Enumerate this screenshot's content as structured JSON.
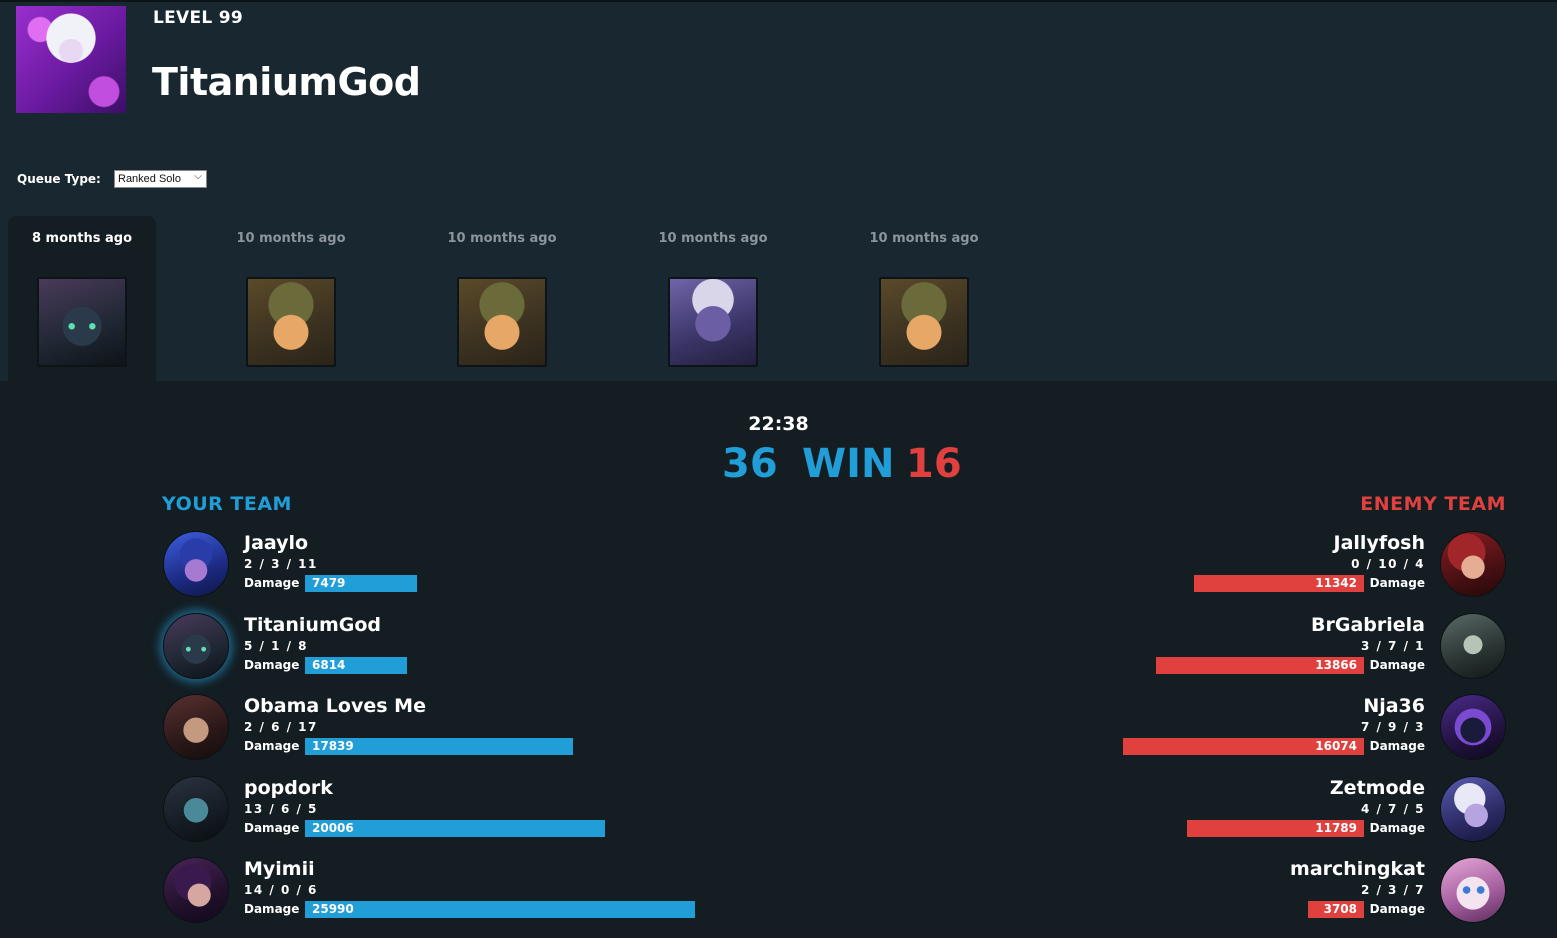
{
  "profile": {
    "level": "LEVEL 99",
    "name": "TitaniumGod",
    "avatar_icon": "profile-avatar-icon"
  },
  "queue": {
    "label": "Queue Type:",
    "selected": "Ranked Solo"
  },
  "matches": [
    {
      "time": "8 months ago",
      "champion_icon": "kindred-icon",
      "active": true
    },
    {
      "time": "10 months ago",
      "champion_icon": "teemo-icon",
      "active": false
    },
    {
      "time": "10 months ago",
      "champion_icon": "teemo-icon",
      "active": false
    },
    {
      "time": "10 months ago",
      "champion_icon": "poppy-icon",
      "active": false
    },
    {
      "time": "10 months ago",
      "champion_icon": "teemo-icon",
      "active": false
    }
  ],
  "match_detail": {
    "duration": "22:38",
    "ally_kills": "36",
    "result": "WIN",
    "enemy_kills": "16",
    "colors": {
      "ally": "#219dd8",
      "enemy": "#e0403e"
    },
    "your_team": {
      "title": "YOUR TEAM",
      "damage_label": "Damage",
      "players": [
        {
          "name": "Jaaylo",
          "kda": "2 / 3 / 11",
          "damage": "7479",
          "champion_icon": "tristana-icon"
        },
        {
          "name": "TitaniumGod",
          "kda": "5 / 1 / 8",
          "damage": "6814",
          "champion_icon": "kindred-icon"
        },
        {
          "name": "Obama Loves Me",
          "kda": "2 / 6 / 17",
          "damage": "17839",
          "champion_icon": "swain-icon"
        },
        {
          "name": "popdork",
          "kda": "13 / 6 / 5",
          "damage": "20006",
          "champion_icon": "kayn-icon"
        },
        {
          "name": "Myimii",
          "kda": "14 / 0 / 6",
          "damage": "25990",
          "champion_icon": "evelynn-icon"
        }
      ]
    },
    "enemy_team": {
      "title": "ENEMY TEAM",
      "damage_label": "Damage",
      "players": [
        {
          "name": "Jallyfosh",
          "kda": "0 / 10 / 4",
          "damage": "11342",
          "champion_icon": "xayah-icon"
        },
        {
          "name": "BrGabriela",
          "kda": "3 / 7 / 1",
          "damage": "13866",
          "champion_icon": "mordekaiser-icon"
        },
        {
          "name": "Nja36",
          "kda": "7 / 9 / 3",
          "damage": "16074",
          "champion_icon": "kassadin-icon"
        },
        {
          "name": "Zetmode",
          "kda": "4 / 7 / 5",
          "damage": "11789",
          "champion_icon": "tristana-icon"
        },
        {
          "name": "marchingkat",
          "kda": "2 / 3 / 7",
          "damage": "3708",
          "champion_icon": "yuumi-icon"
        }
      ]
    }
  }
}
